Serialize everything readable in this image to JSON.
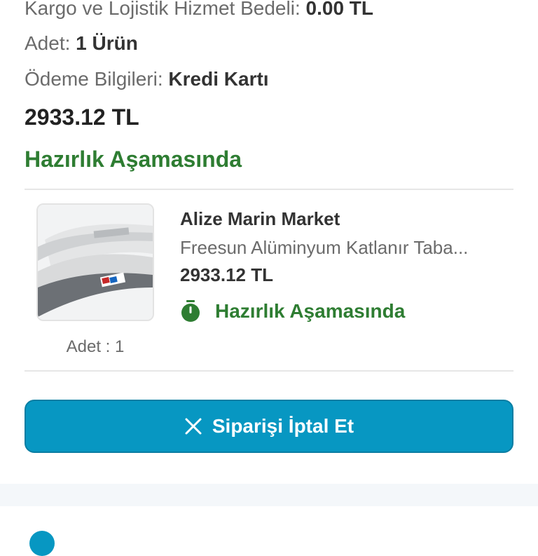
{
  "order_summary": {
    "cargo_label": "Kargo ve Lojistik Hizmet Bedeli:",
    "cargo_value": "0.00 TL",
    "quantity_label": "Adet:",
    "quantity_value": "1 Ürün",
    "payment_label": "Ödeme Bilgileri:",
    "payment_value": "Kredi Kartı",
    "total": "2933.12 TL",
    "status": "Hazırlık Aşamasında"
  },
  "product": {
    "store": "Alize Marin Market",
    "name": "Freesun Alüminyum Katlanır Taba...",
    "price": "2933.12 TL",
    "status": "Hazırlık Aşamasında",
    "quantity": "Adet : 1",
    "status_icon": "timer-icon"
  },
  "actions": {
    "cancel_label": "Siparişi İptal Et",
    "cancel_icon": "close-icon"
  },
  "colors": {
    "status_green": "#2e7d32",
    "button_blue": "#0797c2"
  }
}
